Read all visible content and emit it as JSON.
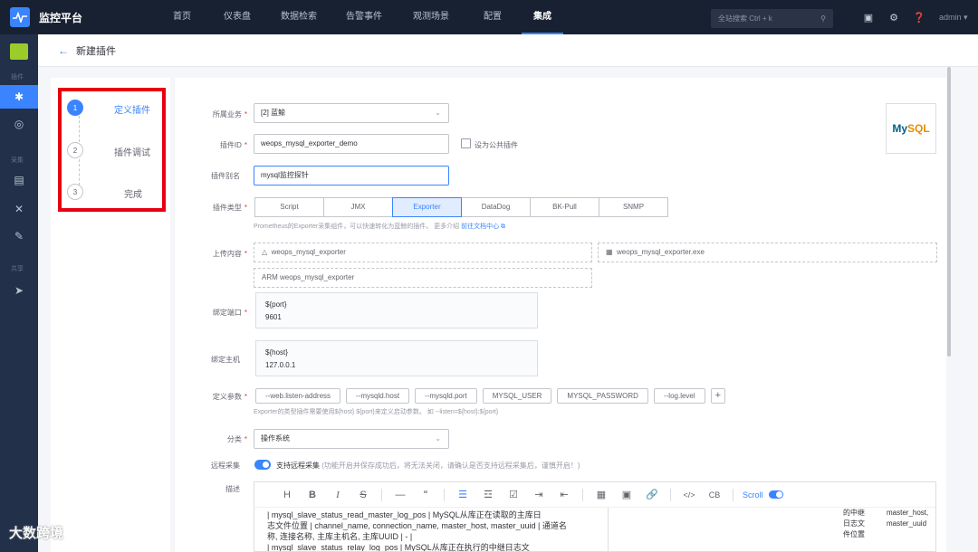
{
  "app": {
    "title": "监控平台"
  },
  "nav": {
    "items": [
      {
        "label": "首页",
        "width": 0
      },
      {
        "label": "仪表盘"
      },
      {
        "label": "数据检索"
      },
      {
        "label": "告警事件"
      },
      {
        "label": "观测场景"
      },
      {
        "label": "配置"
      },
      {
        "label": "集成"
      }
    ],
    "search_placeholder": "全站搜索 Ctrl + k",
    "user": "admin ▾"
  },
  "rail": {
    "labels": {
      "plugin": "插件",
      "collect": "采集",
      "share": "共享"
    }
  },
  "page": {
    "title": "新建插件"
  },
  "steps": [
    {
      "num": "1",
      "label": "定义插件"
    },
    {
      "num": "2",
      "label": "插件调试"
    },
    {
      "num": "3",
      "label": "完成"
    }
  ],
  "form": {
    "business": {
      "label": "所属业务",
      "value": "[2] 蓝鲸"
    },
    "plugin_id": {
      "label": "插件ID",
      "value": "weops_mysql_exporter_demo",
      "public_label": "设为公共插件"
    },
    "alias": {
      "label": "插件别名",
      "value": "mysql监控探针"
    },
    "type": {
      "label": "插件类型",
      "options": [
        "Script",
        "JMX",
        "Exporter",
        "DataDog",
        "BK-Pull",
        "SNMP"
      ],
      "selected": "Exporter",
      "hint": "Prometheus的Exporter采集组件，可以快速转化为蓝鲸的插件。 更多介绍 ",
      "hint_link": "前往文档中心"
    },
    "upload": {
      "label": "上传内容",
      "linux": "weops_mysql_exporter",
      "windows": "weops_mysql_exporter.exe",
      "arm": "ARM weops_mysql_exporter"
    },
    "port": {
      "label": "绑定端口",
      "var": "${port}",
      "value": "9601"
    },
    "host": {
      "label": "绑定主机",
      "var": "${host}",
      "value": "127.0.0.1"
    },
    "params": {
      "label": "定义参数",
      "tags": [
        "--web.listen-address",
        "--mysqld.host",
        "--mysqld.port",
        "MYSQL_USER",
        "MYSQL_PASSWORD",
        "--log.level"
      ],
      "plus": "+",
      "hint": "Exporter的类型插件需要使用${host} ${port}来定义启动参数。 如 --listen=${host}:${port}"
    },
    "category": {
      "label": "分类",
      "value": "操作系统"
    },
    "remote": {
      "label": "远程采集",
      "text": "支持远程采集",
      "hint": "(功能开启并保存成功后，将无法关闭，请确认是否支持远程采集后，谨慎开启！)"
    },
    "desc": {
      "label": "描述",
      "toolbar": {
        "scroll": "Scroll"
      },
      "content": [
        "| mysql_slave_status_read_master_log_pos         | MySQL从库正在读取的主库日",
        "志文件位置  | channel_name, connection_name, master_host, master_uuid | 通道名",
        "称, 连接名称, 主库主机名, 主库UUID  | -      |",
        "| mysql_slave_status_relay_log_pos               | MySQL从库正在执行的中继日志文"
      ],
      "preview_col1": [
        "的中继",
        "日志文",
        "件位置"
      ],
      "preview_col2": [
        "master_host,",
        "master_uuid"
      ]
    }
  },
  "watermark": "大数跨境",
  "colors": {
    "topbar": "#182132",
    "rail": "#22304a",
    "accent": "#3a84ff",
    "highlight": "#e60012"
  }
}
